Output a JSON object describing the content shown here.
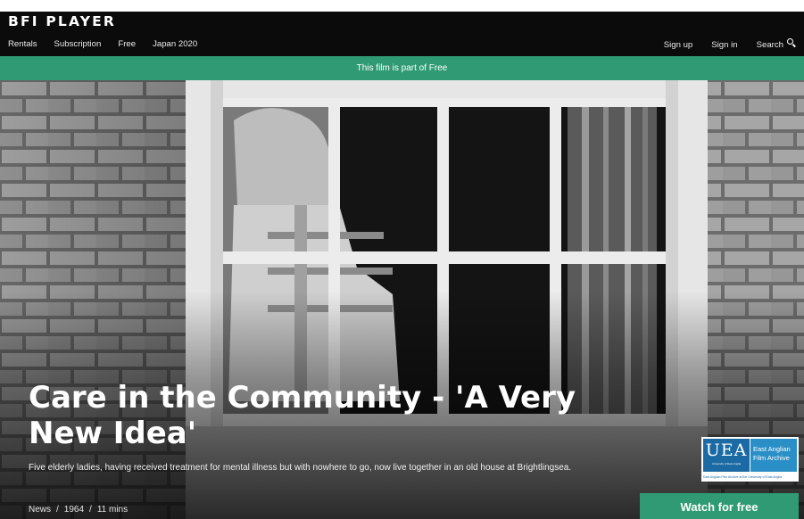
{
  "header": {
    "logo": "BFI PLAYER",
    "nav_left": [
      "Rentals",
      "Subscription",
      "Free",
      "Japan 2020"
    ],
    "nav_right": [
      "Sign up",
      "Sign in",
      "Search"
    ]
  },
  "notice": {
    "text": "This film is part of Free"
  },
  "film": {
    "title": "Care in the Community - 'A Very New Idea'",
    "description": "Five elderly ladies, having received treatment for mental illness but with nowhere to go, now live together in an old house at Brightlingsea.",
    "genre": "News",
    "year": "1964",
    "duration": "11 mins"
  },
  "archive_logo": {
    "mark": "UEA",
    "mark_sub": "University of East Anglia",
    "name": "East Anglian Film Archive",
    "footer": "East Anglian Film Archive at the University of East Anglia"
  },
  "cta": {
    "label": "Watch for free"
  },
  "colors": {
    "accent": "#2f9a74",
    "topbar": "#0b0b0c"
  }
}
